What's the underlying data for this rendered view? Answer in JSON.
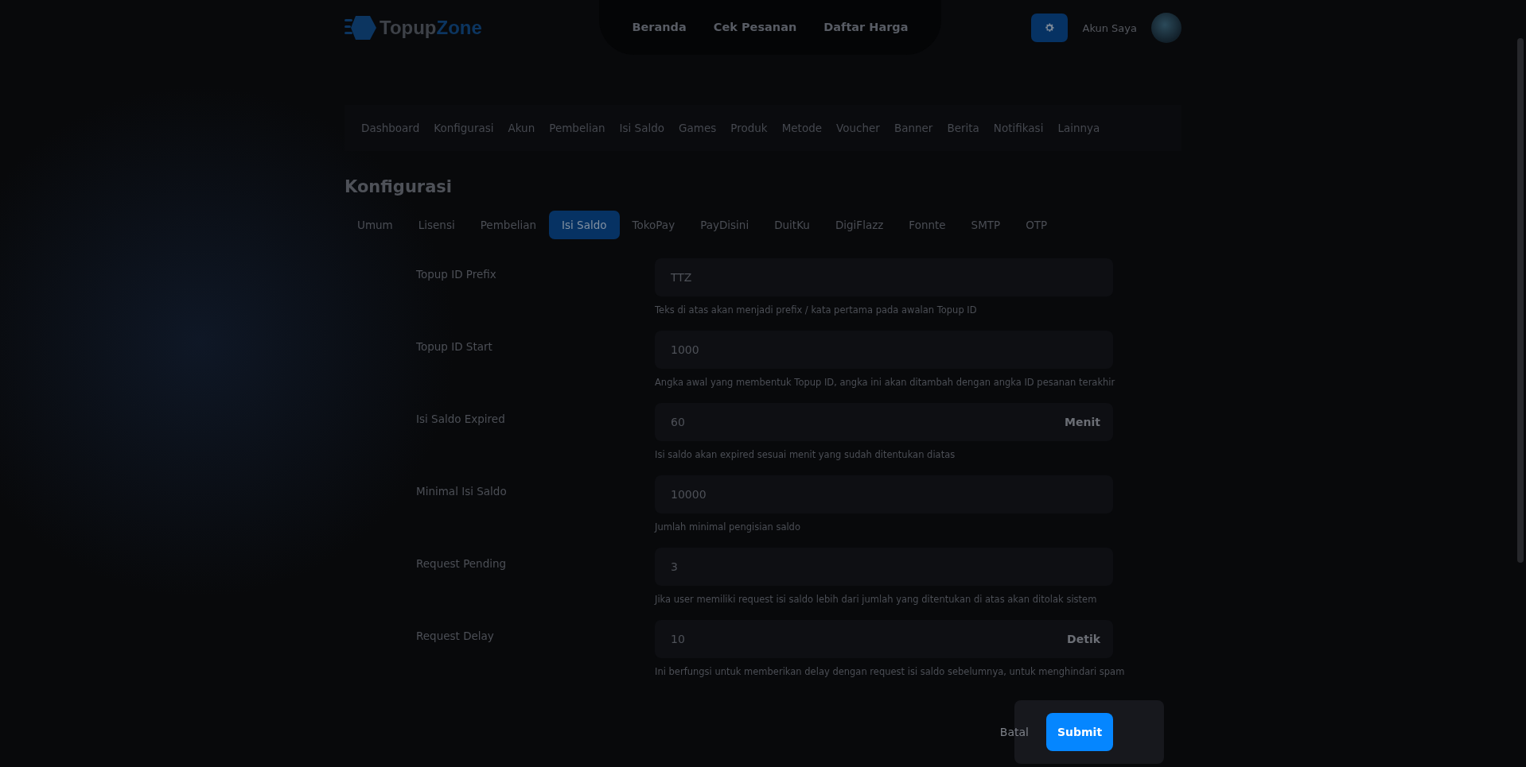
{
  "header": {
    "logo": {
      "part1": "Topup",
      "part2": "Zone"
    },
    "nav": [
      {
        "label": "Beranda"
      },
      {
        "label": "Cek Pesanan"
      },
      {
        "label": "Daftar Harga"
      }
    ],
    "account": "Akun Saya"
  },
  "admin_nav": [
    {
      "label": "Dashboard",
      "selected": false
    },
    {
      "label": "Konfigurasi",
      "selected": false
    },
    {
      "label": "Akun",
      "selected": false
    },
    {
      "label": "Pembelian",
      "selected": false
    },
    {
      "label": "Isi Saldo",
      "selected": false
    },
    {
      "label": "Games",
      "selected": false
    },
    {
      "label": "Produk",
      "selected": false
    },
    {
      "label": "Metode",
      "selected": false
    },
    {
      "label": "Voucher",
      "selected": false
    },
    {
      "label": "Banner",
      "selected": false
    },
    {
      "label": "Berita",
      "selected": false
    },
    {
      "label": "Notifikasi",
      "selected": false
    },
    {
      "label": "Lainnya",
      "selected": false
    }
  ],
  "title": "Konfigurasi",
  "tabs": [
    {
      "label": "Umum",
      "selected": false
    },
    {
      "label": "Lisensi",
      "selected": false
    },
    {
      "label": "Pembelian",
      "selected": false
    },
    {
      "label": "Isi Saldo",
      "selected": true
    },
    {
      "label": "TokoPay",
      "selected": false
    },
    {
      "label": "PayDisini",
      "selected": false
    },
    {
      "label": "DuitKu",
      "selected": false
    },
    {
      "label": "DigiFlazz",
      "selected": false
    },
    {
      "label": "Fonnte",
      "selected": false
    },
    {
      "label": "SMTP",
      "selected": false
    },
    {
      "label": "OTP",
      "selected": false
    }
  ],
  "fields": [
    {
      "label": "Topup ID Prefix",
      "value": "TTZ",
      "help": "Teks di atas akan menjadi prefix / kata pertama pada awalan Topup ID"
    },
    {
      "label": "Topup ID Start",
      "value": "1000",
      "help": "Angka awal yang membentuk Topup ID, angka ini akan ditambah dengan angka ID pesanan terakhir"
    },
    {
      "label": "Isi Saldo Expired",
      "value": "60",
      "suffix": "Menit",
      "help": "Isi saldo akan expired sesuai menit yang sudah ditentukan diatas"
    },
    {
      "label": "Minimal Isi Saldo",
      "value": "10000",
      "help": "Jumlah minimal pengisian saldo"
    },
    {
      "label": "Request Pending",
      "value": "3",
      "help": "Jika user memiliki request isi saldo lebih dari jumlah yang ditentukan di atas akan ditolak sistem"
    },
    {
      "label": "Request Delay",
      "value": "10",
      "suffix": "Detik",
      "help": "Ini berfungsi untuk memberikan delay dengan request isi saldo sebelumnya, untuk menghindari spam"
    }
  ],
  "actions": {
    "cancel": "Batal",
    "submit": "Submit"
  }
}
